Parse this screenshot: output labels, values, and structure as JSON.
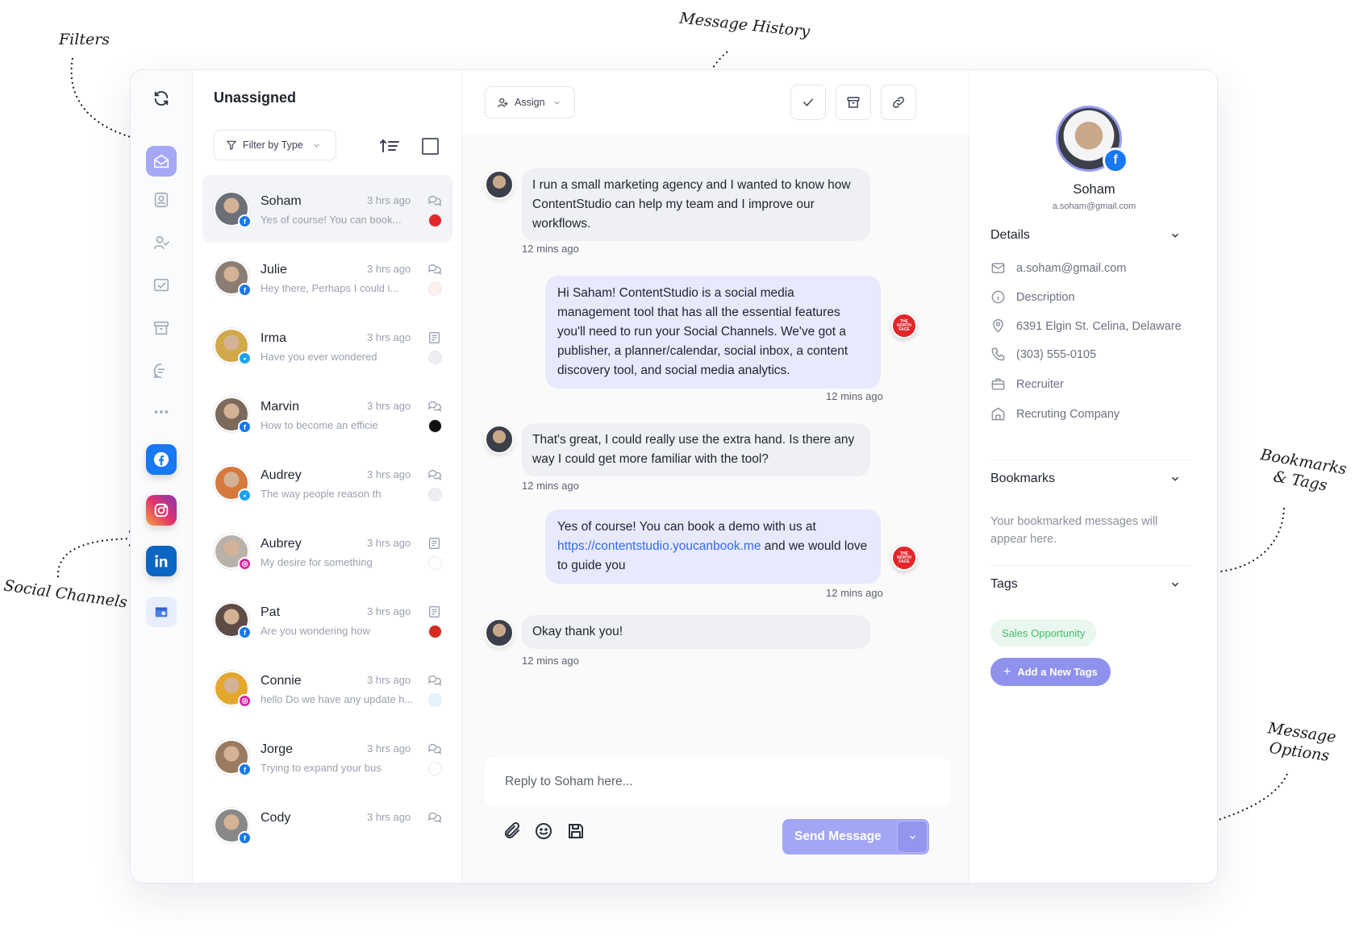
{
  "annotations": {
    "filters": "Filters",
    "message_history": "Message History",
    "social_channels": "Social Channels",
    "bookmarks_tags": [
      "Bookmarks",
      "& Tags"
    ],
    "message_options": [
      "Message",
      "Options"
    ]
  },
  "sidebar": {
    "icons": [
      "refresh-icon",
      "inbox-icon",
      "contact-icon",
      "user-check-icon",
      "check-square-icon",
      "archive-icon",
      "chat-list-icon",
      "more-icon"
    ],
    "channels": [
      "facebook-icon",
      "instagram-icon",
      "linkedin-icon",
      "google-business-icon"
    ]
  },
  "conversations": {
    "title": "Unassigned",
    "filter_label": "Filter by Type",
    "items": [
      {
        "name": "Soham",
        "preview": "Yes of course! You can book...",
        "time": "3 hrs ago",
        "channel": "facebook",
        "type": "comment-icon",
        "brand": "north-face"
      },
      {
        "name": "Julie",
        "preview": "Hey there, Perhaps I could i...",
        "time": "3 hrs ago",
        "channel": "facebook",
        "type": "comment-icon",
        "brand": "wendys"
      },
      {
        "name": "Irma",
        "preview": "Have you ever wondered",
        "time": "3 hrs ago",
        "channel": "twitter",
        "type": "post-icon",
        "brand": "amazon"
      },
      {
        "name": "Marvin",
        "preview": "How to become an efficie",
        "time": "3 hrs ago",
        "channel": "facebook",
        "type": "comment-icon",
        "brand": "netflix"
      },
      {
        "name": "Audrey",
        "preview": "The way people reason th",
        "time": "3 hrs ago",
        "channel": "twitter",
        "type": "comment-icon",
        "brand": "amazon"
      },
      {
        "name": "Aubrey",
        "preview": "My desire for something",
        "time": "3 hrs ago",
        "channel": "instagram",
        "type": "post-icon",
        "brand": "eni"
      },
      {
        "name": "Pat",
        "preview": "Are you wondering how",
        "time": "3 hrs ago",
        "channel": "facebook",
        "type": "post-icon",
        "brand": "mcdonalds"
      },
      {
        "name": "Connie",
        "preview": "hello Do we have any update h...",
        "time": "3 hrs ago",
        "channel": "instagram",
        "type": "comment-icon",
        "brand": "salesforce"
      },
      {
        "name": "Jorge",
        "preview": "Trying to expand your bus",
        "time": "3 hrs ago",
        "channel": "facebook",
        "type": "comment-icon",
        "brand": "microsoft"
      },
      {
        "name": "Cody",
        "preview": "",
        "time": "3 hrs ago",
        "channel": "facebook",
        "type": "comment-icon",
        "brand": ""
      }
    ]
  },
  "chat": {
    "assign_label": "Assign",
    "messages": [
      {
        "direction": "in",
        "text": "I run a small marketing agency and I wanted to know how ContentStudio can help my team and I improve our workflows.",
        "time": "12 mins ago"
      },
      {
        "direction": "out",
        "text": "Hi Saham! ContentStudio is a social media management tool that has all the essential features you'll need to run your Social Channels. We've got a publisher, a planner/calendar, social inbox, a content discovery tool, and social media analytics.",
        "time": "12 mins ago"
      },
      {
        "direction": "in",
        "text": "That's great, I could really use the extra hand. Is there any way I could get more familiar with the tool?",
        "time": "12 mins ago"
      },
      {
        "direction": "out",
        "text_before": "Yes of course! You can book a demo with us at ",
        "link": "https://contentstudio.youcanbook.me",
        "text_after": " and we would love to guide you",
        "time": "12 mins ago"
      },
      {
        "direction": "in",
        "text": "Okay thank you!",
        "time": "12 mins ago"
      }
    ],
    "brand_badge": "THE NORTH FACE",
    "reply_placeholder": "Reply to Soham here...",
    "send_label": "Send Message"
  },
  "profile": {
    "name": "Soham",
    "email": "a.soham@gmail.com",
    "details_title": "Details",
    "details": {
      "email": "a.soham@gmail.com",
      "description": "Description",
      "address": "6391 Elgin St. Celina, Delaware",
      "phone": "(303) 555-0105",
      "role": "Recruiter",
      "company": "Recruting Company"
    },
    "bookmarks_title": "Bookmarks",
    "bookmarks_empty": "Your bookmarked messages will appear here.",
    "tags_title": "Tags",
    "tags": [
      "Sales Opportunity"
    ],
    "add_tag_label": "Add a New Tags"
  },
  "colors": {
    "accent": "#a3a6f4",
    "facebook": "#1877f2",
    "tag_green": "#45bb6c"
  }
}
